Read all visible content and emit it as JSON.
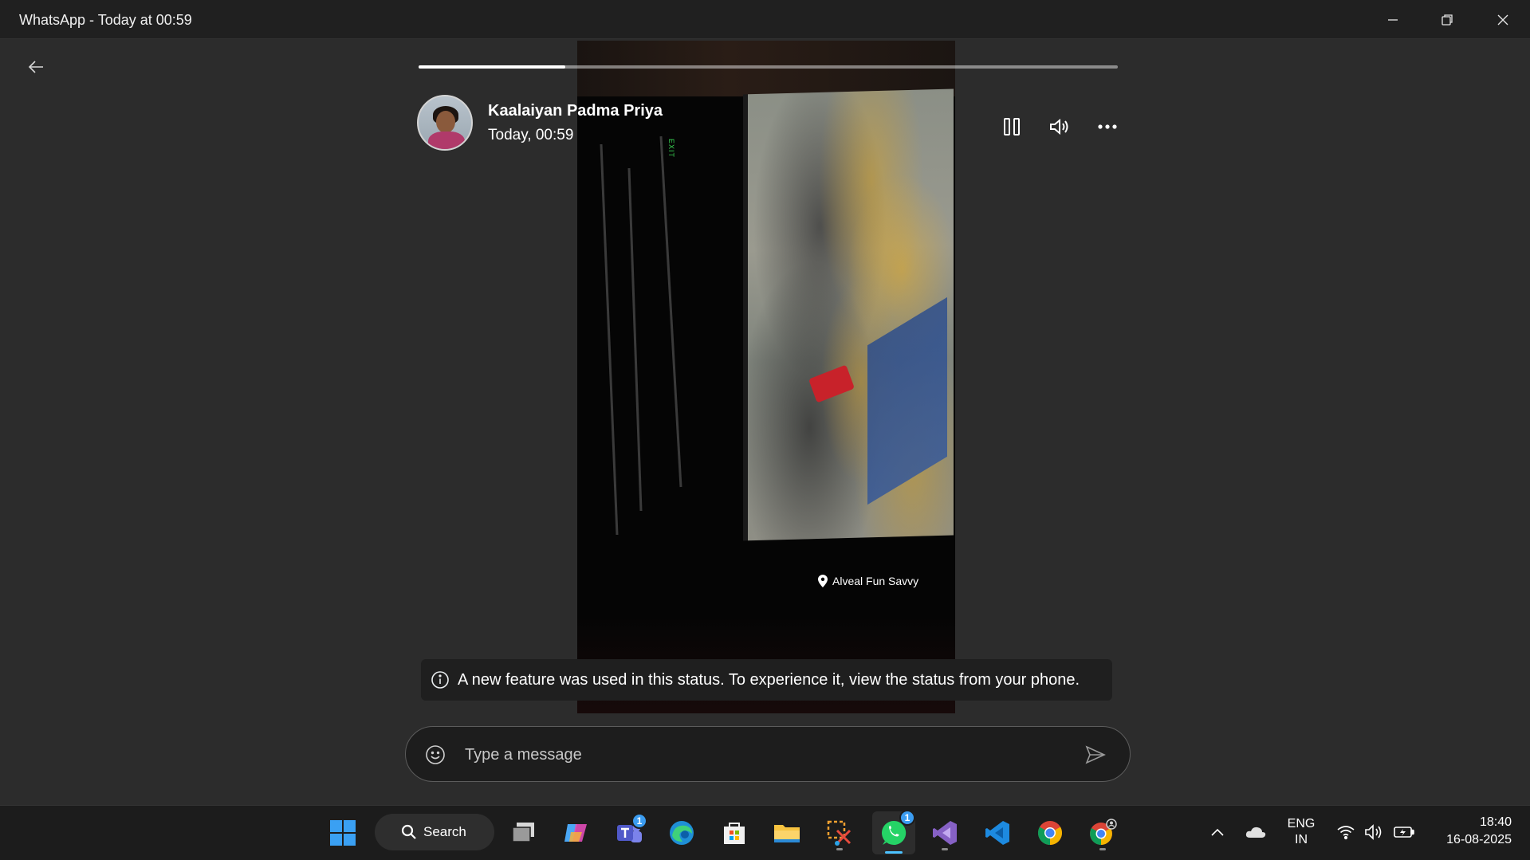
{
  "window": {
    "title": "WhatsApp - Today at 00:59",
    "minimize_icon": "minimize-icon",
    "restore_icon": "restore-icon",
    "close_icon": "close-icon"
  },
  "status": {
    "progress_fraction": 0.21,
    "contact_name": "Kaalaiyan Padma Priya",
    "timestamp": "Today, 00:59",
    "location_label": "Alveal Fun Savvy",
    "notice_text": "A new feature was used in this status. To experience it, view the status from your phone."
  },
  "composer": {
    "placeholder": "Type a message"
  },
  "taskbar": {
    "search_label": "Search",
    "apps": [
      {
        "name": "windows-start-icon"
      },
      {
        "name": "task-view-icon"
      },
      {
        "name": "copilot-icon"
      },
      {
        "name": "teams-icon",
        "badge": "1"
      },
      {
        "name": "edge-icon"
      },
      {
        "name": "microsoft-store-icon"
      },
      {
        "name": "file-explorer-icon"
      },
      {
        "name": "snipping-tool-icon"
      },
      {
        "name": "whatsapp-icon",
        "badge": "1"
      },
      {
        "name": "visual-studio-icon"
      },
      {
        "name": "vscode-icon"
      },
      {
        "name": "chrome-icon"
      },
      {
        "name": "chrome-profile-icon"
      }
    ],
    "tray": {
      "lang_line1": "ENG",
      "lang_line2": "IN",
      "time": "18:40",
      "date": "16-08-2025"
    }
  },
  "colors": {
    "background": "#2c2c2c",
    "accent_blue": "#4cc2ff",
    "whatsapp_green": "#25d366"
  }
}
